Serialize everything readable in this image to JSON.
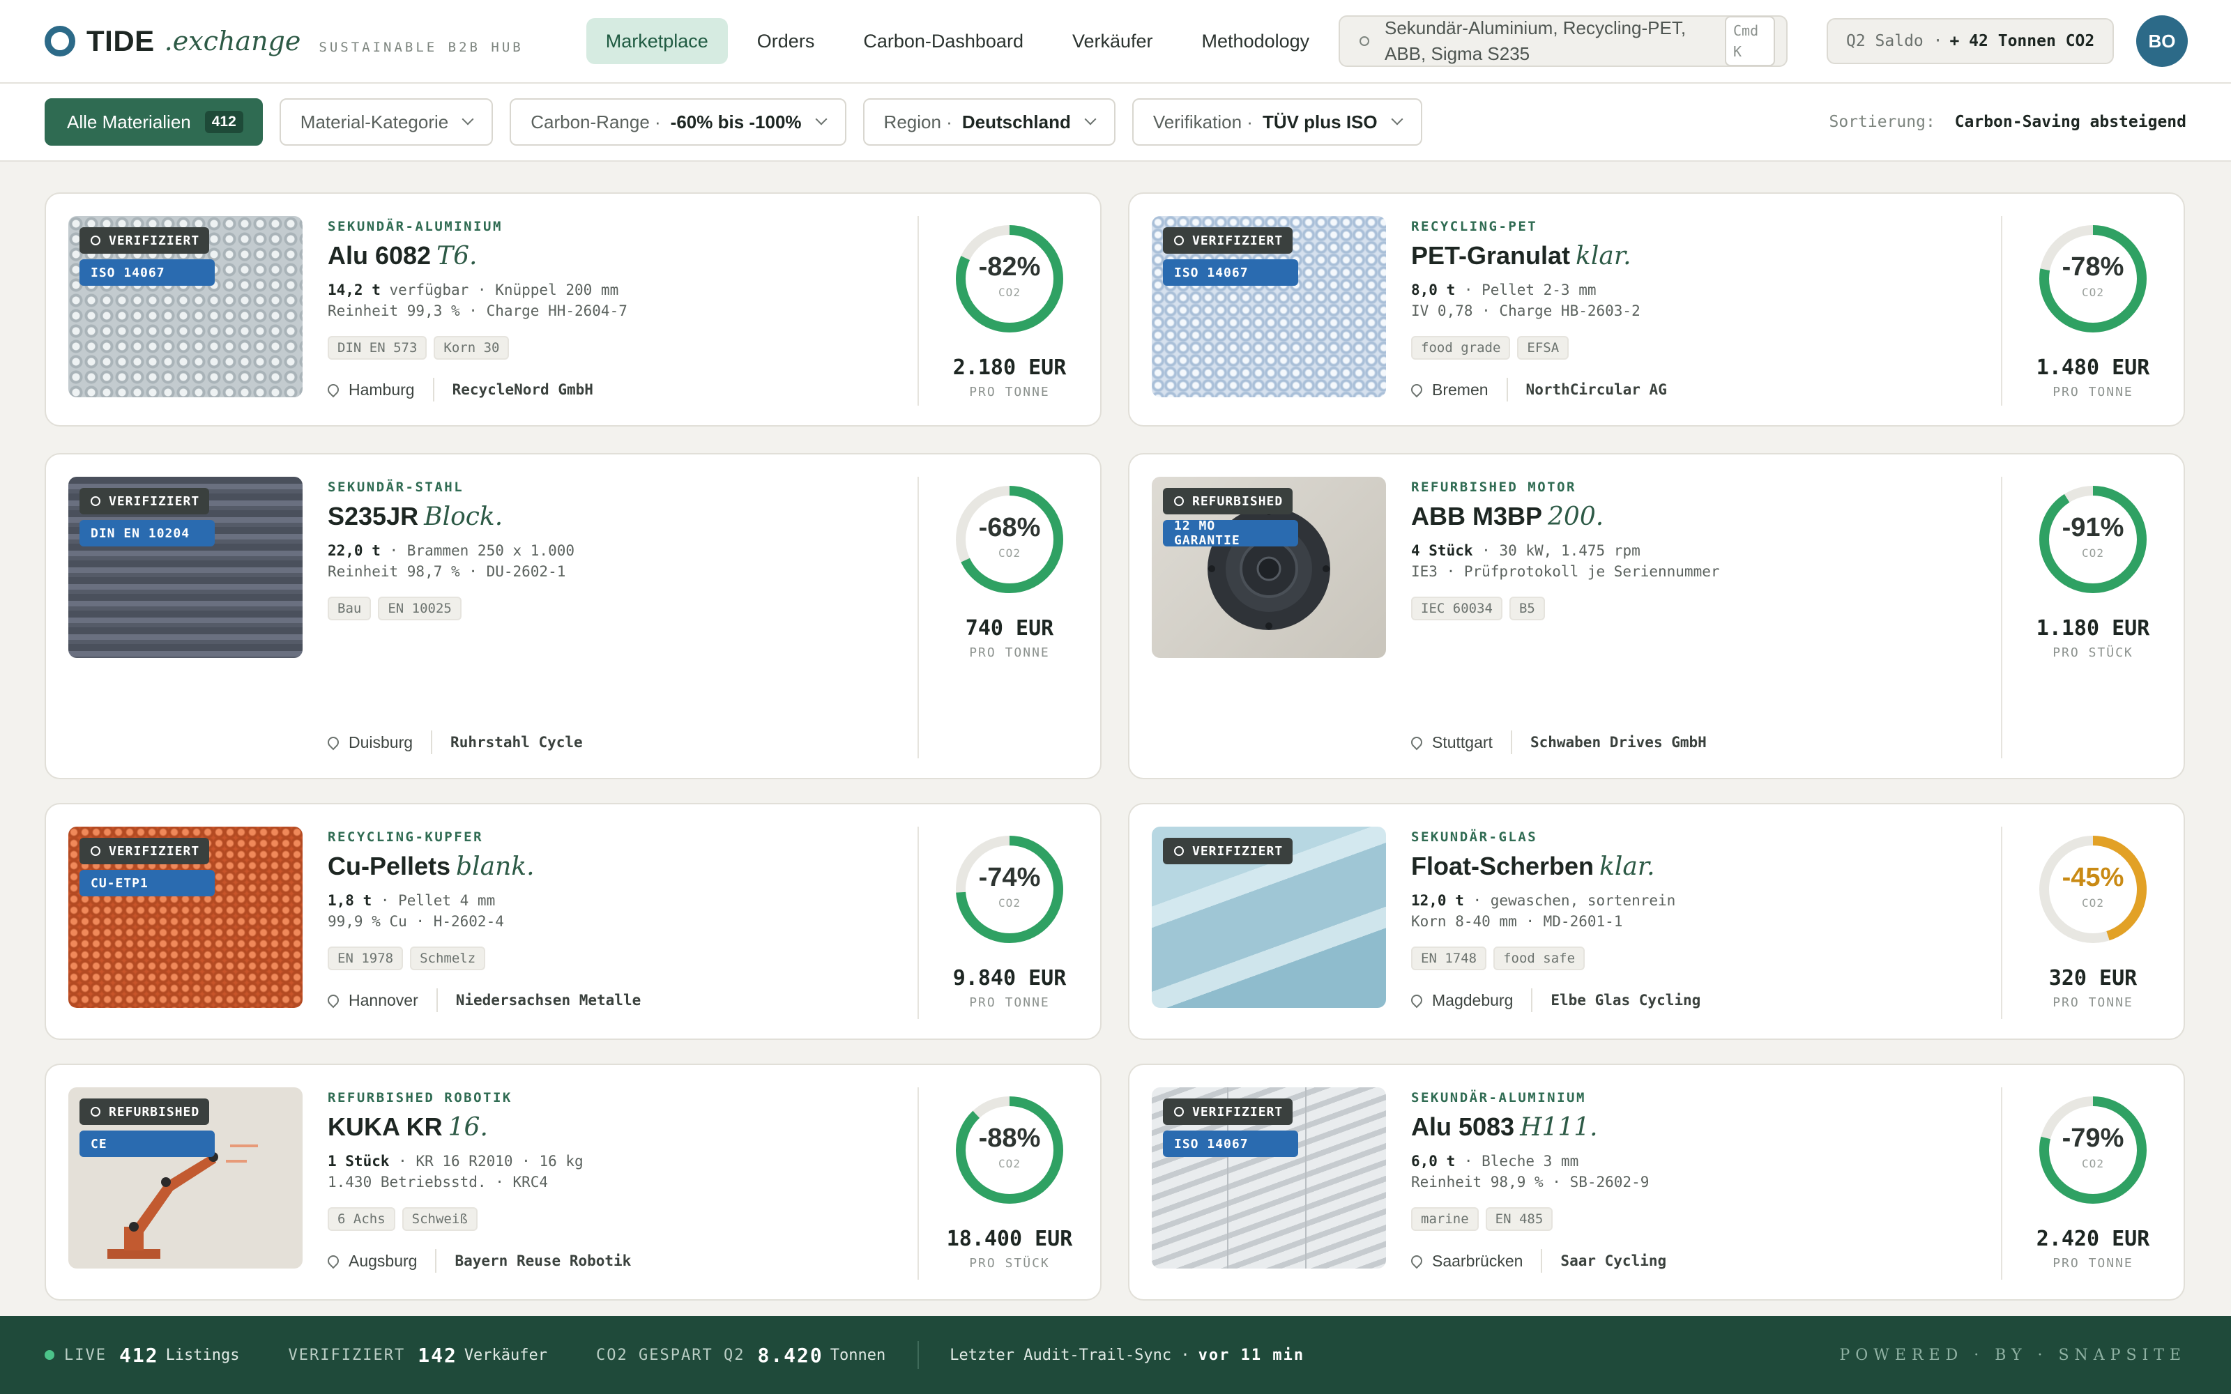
{
  "header": {
    "logo_name": "TIDE",
    "logo_suffix": ".exchange",
    "logo_tagline": "SUSTAINABLE B2B HUB",
    "nav": [
      "Marketplace",
      "Orders",
      "Carbon-Dashboard",
      "Verkäufer",
      "Methodology"
    ],
    "active_nav": "Marketplace",
    "search_text": "Sekundär-Aluminium, Recycling-PET, ABB, Sigma S235",
    "search_shortcut": "Cmd K",
    "saldo_label": "Q2 Saldo ·",
    "saldo_value": "+ 42 Tonnen CO2",
    "avatar_initials": "BO"
  },
  "filters": {
    "all_label": "Alle Materialien",
    "all_count": "412",
    "category_label": "Material-Kategorie",
    "carbon_label": "Carbon-Range ·",
    "carbon_value": "-60% bis -100%",
    "region_label": "Region ·",
    "region_value": "Deutschland",
    "verification_label": "Verifikation ·",
    "verification_value": "TÜV plus ISO",
    "sort_label": "Sortierung:",
    "sort_value": "Carbon-Saving absteigend"
  },
  "listings": [
    {
      "category": "SEKUNDÄR-ALUMINIUM",
      "name": "Alu 6082",
      "variant": "T6.",
      "qty": "14,2 t",
      "spec1_rest": " verfügbar · Knüppel 200 mm",
      "spec2": "Reinheit 99,3 % · Charge HH-2604-7",
      "tags": [
        "DIN EN 573",
        "Korn 30"
      ],
      "city": "Hamburg",
      "seller": "RecycleNord GmbH",
      "badge1": "VERIFIZIERT",
      "badge2": "ISO 14067",
      "co2_pct": "-82%",
      "co2_fraction": 0.82,
      "co2_label": "CO2",
      "price": "2.180 EUR",
      "unit": "PRO TONNE",
      "ring_color": "#2fa163"
    },
    {
      "category": "RECYCLING-PET",
      "name": "PET-Granulat",
      "variant": "klar.",
      "qty": "8,0 t",
      "spec1_rest": " · Pellet 2-3 mm",
      "spec2": "IV 0,78 · Charge HB-2603-2",
      "tags": [
        "food grade",
        "EFSA"
      ],
      "city": "Bremen",
      "seller": "NorthCircular AG",
      "badge1": "VERIFIZIERT",
      "badge2": "ISO 14067",
      "co2_pct": "-78%",
      "co2_fraction": 0.78,
      "co2_label": "CO2",
      "price": "1.480 EUR",
      "unit": "PRO TONNE",
      "ring_color": "#2fa163"
    },
    {
      "category": "SEKUNDÄR-STAHL",
      "name": "S235JR",
      "variant": "Block.",
      "qty": "22,0 t",
      "spec1_rest": " · Brammen 250 x 1.000",
      "spec2": "Reinheit 98,7 % · DU-2602-1",
      "tags": [
        "Bau",
        "EN 10025"
      ],
      "city": "Duisburg",
      "seller": "Ruhrstahl Cycle",
      "badge1": "VERIFIZIERT",
      "badge2": "DIN EN 10204",
      "co2_pct": "-68%",
      "co2_fraction": 0.68,
      "co2_label": "CO2",
      "price": "740 EUR",
      "unit": "PRO TONNE",
      "ring_color": "#2fa163"
    },
    {
      "category": "REFURBISHED MOTOR",
      "name": "ABB M3BP",
      "variant": "200.",
      "qty": "4 Stück",
      "spec1_rest": " · 30 kW, 1.475 rpm",
      "spec2": "IE3 · Prüfprotokoll je Seriennummer",
      "tags": [
        "IEC 60034",
        "B5"
      ],
      "city": "Stuttgart",
      "seller": "Schwaben Drives GmbH",
      "badge1": "REFURBISHED",
      "badge2": "12 MO GARANTIE",
      "co2_pct": "-91%",
      "co2_fraction": 0.91,
      "co2_label": "CO2",
      "price": "1.180 EUR",
      "unit": "PRO STÜCK",
      "ring_color": "#2fa163"
    },
    {
      "category": "RECYCLING-KUPFER",
      "name": "Cu-Pellets",
      "variant": "blank.",
      "qty": "1,8 t",
      "spec1_rest": " · Pellet 4 mm",
      "spec2": "99,9 % Cu · H-2602-4",
      "tags": [
        "EN 1978",
        "Schmelz"
      ],
      "city": "Hannover",
      "seller": "Niedersachsen Metalle",
      "badge1": "VERIFIZIERT",
      "badge2": "CU-ETP1",
      "co2_pct": "-74%",
      "co2_fraction": 0.74,
      "co2_label": "CO2",
      "price": "9.840 EUR",
      "unit": "PRO TONNE",
      "ring_color": "#2fa163"
    },
    {
      "category": "SEKUNDÄR-GLAS",
      "name": "Float-Scherben",
      "variant": "klar.",
      "qty": "12,0 t",
      "spec1_rest": " · gewaschen, sortenrein",
      "spec2": "Korn 8-40 mm · MD-2601-1",
      "tags": [
        "EN 1748",
        "food safe"
      ],
      "city": "Magdeburg",
      "seller": "Elbe Glas Cycling",
      "badge1": "VERIFIZIERT",
      "badge2": "",
      "co2_pct": "-45%",
      "co2_fraction": 0.45,
      "co2_label": "CO2",
      "price": "320 EUR",
      "unit": "PRO TONNE",
      "ring_color": "#e2a126"
    },
    {
      "category": "REFURBISHED ROBOTIK",
      "name": "KUKA KR",
      "variant": "16.",
      "qty": "1 Stück",
      "spec1_rest": " · KR 16 R2010 · 16 kg",
      "spec2": "1.430 Betriebsstd. · KRC4",
      "tags": [
        "6 Achs",
        "Schweiß"
      ],
      "city": "Augsburg",
      "seller": "Bayern Reuse Robotik",
      "badge1": "REFURBISHED",
      "badge2": "CE",
      "co2_pct": "-88%",
      "co2_fraction": 0.88,
      "co2_label": "CO2",
      "price": "18.400 EUR",
      "unit": "PRO STÜCK",
      "ring_color": "#2fa163"
    },
    {
      "category": "SEKUNDÄR-ALUMINIUM",
      "name": "Alu 5083",
      "variant": "H111.",
      "qty": "6,0 t",
      "spec1_rest": " · Bleche 3 mm",
      "spec2": "Reinheit 98,9 % · SB-2602-9",
      "tags": [
        "marine",
        "EN 485"
      ],
      "city": "Saarbrücken",
      "seller": "Saar Cycling",
      "badge1": "VERIFIZIERT",
      "badge2": "ISO 14067",
      "co2_pct": "-79%",
      "co2_fraction": 0.79,
      "co2_label": "CO2",
      "price": "2.420 EUR",
      "unit": "PRO TONNE",
      "ring_color": "#2fa163"
    }
  ],
  "footer": {
    "live_label": "LIVE",
    "live_value": "412",
    "live_unit": "Listings",
    "verified_label": "VERIFIZIERT",
    "verified_value": "142",
    "verified_unit": "Verkäufer",
    "co2_label": "CO2 GESPART Q2",
    "co2_value": "8.420",
    "co2_unit": "Tonnen",
    "sync_label": "Letzter Audit-Trail-Sync ·",
    "sync_value": "vor 11 min",
    "powered": "POWERED · BY · SNAPSITE"
  }
}
